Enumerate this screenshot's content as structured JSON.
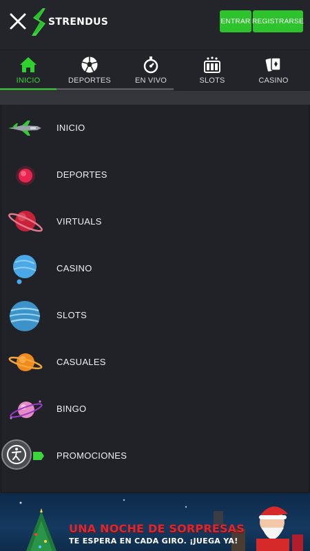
{
  "header": {
    "logo_text": "STRENDUS",
    "login_label": "ENTRAR",
    "register_label": "REGISTRARSE"
  },
  "tabs": [
    {
      "label": "INICIO",
      "icon": "home-icon",
      "active": true
    },
    {
      "label": "DEPORTES",
      "icon": "soccer-ball-icon",
      "active": false
    },
    {
      "label": "EN VIVO",
      "icon": "stopwatch-icon",
      "active": false
    },
    {
      "label": "SLOTS",
      "icon": "slot-machine-icon",
      "active": false
    },
    {
      "label": "CASINO",
      "icon": "cards-icon",
      "active": false
    }
  ],
  "menu": {
    "items": [
      {
        "label": "INICIO",
        "icon": "spaceship-icon"
      },
      {
        "label": "DEPORTES",
        "icon": "red-planet-icon"
      },
      {
        "label": "VIRTUALS",
        "icon": "ringed-red-planet-icon"
      },
      {
        "label": "CASINO",
        "icon": "blue-planet-icon"
      },
      {
        "label": "SLOTS",
        "icon": "striped-planet-icon"
      },
      {
        "label": "CASUALES",
        "icon": "orange-ringed-planet-icon"
      },
      {
        "label": "BINGO",
        "icon": "pink-planet-icon"
      },
      {
        "label": "PROMOCIONES",
        "icon": "green-badge-icon"
      }
    ]
  },
  "banner": {
    "title": "UNA NOCHE DE SORPRESAS",
    "subtitle": "TE ESPERA EN CADA GIRO. ¡JUEGA YA!"
  },
  "colors": {
    "accent": "#2cc32c",
    "background": "#202228",
    "active_tab": "#37d637"
  }
}
